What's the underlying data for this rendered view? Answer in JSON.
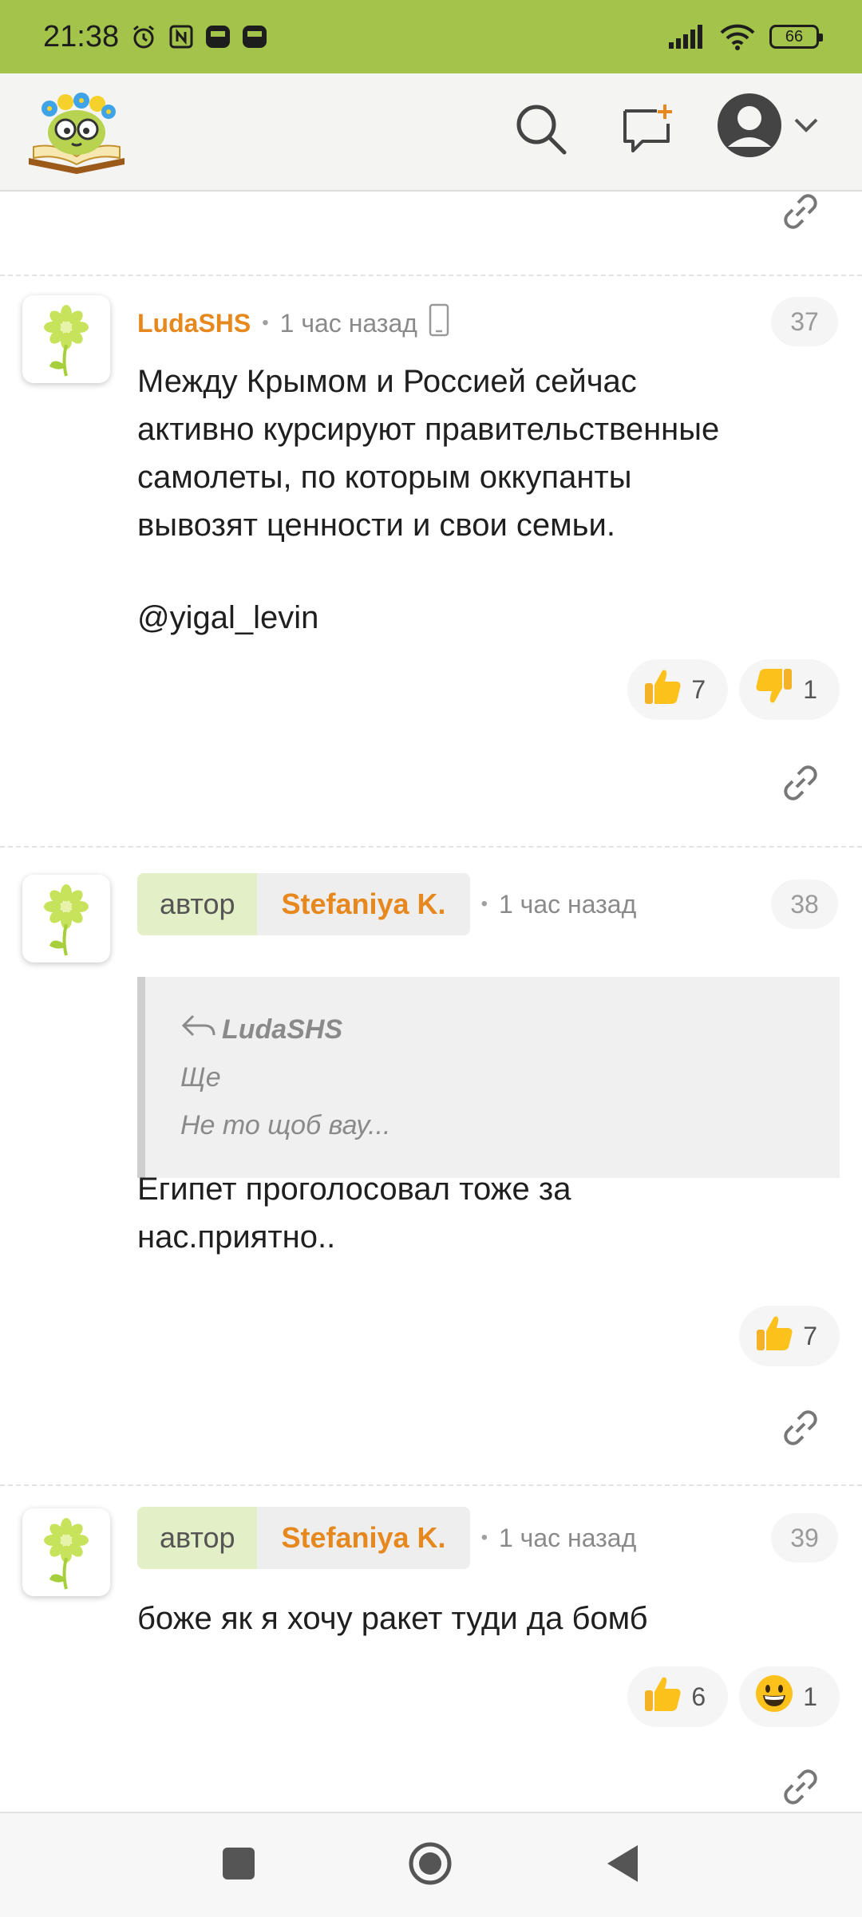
{
  "status_bar": {
    "time": "21:38",
    "battery": "66"
  },
  "comments": [
    {
      "author": "LudaSHS",
      "time": "1 час назад",
      "number": "37",
      "text_lines": [
        "Между Крымом и Россией сейчас",
        "активно курсируют правительственные",
        "самолеты, по которым оккупанты",
        "вывозят ценности и свои семьи.",
        "",
        "@yigal_levin"
      ],
      "reactions": [
        {
          "icon": "thumbs-up-icon",
          "count": "7"
        },
        {
          "icon": "thumbs-down-icon",
          "count": "1"
        }
      ]
    },
    {
      "role": "автор",
      "author": "Stefaniya K.",
      "time": "1 час назад",
      "number": "38",
      "quote": {
        "author": "LudaSHS",
        "line1": "Ще",
        "line2": "Не то щоб вау..."
      },
      "text_lines": [
        "Египет проголосовал тоже за",
        "нас.приятно.."
      ],
      "reactions": [
        {
          "icon": "thumbs-up-icon",
          "count": "7"
        }
      ]
    },
    {
      "role": "автор",
      "author": "Stefaniya K.",
      "time": "1 час назад",
      "number": "39",
      "text_lines": [
        "боже як я хочу ракет туди да бомб"
      ],
      "reactions": [
        {
          "icon": "thumbs-up-icon",
          "count": "6"
        },
        {
          "icon": "grinning-face-icon",
          "count": "1"
        }
      ]
    }
  ],
  "colors": {
    "status_bar": "#a3c34a",
    "author": "#e6881d",
    "author_badge": "#e3efc6"
  }
}
